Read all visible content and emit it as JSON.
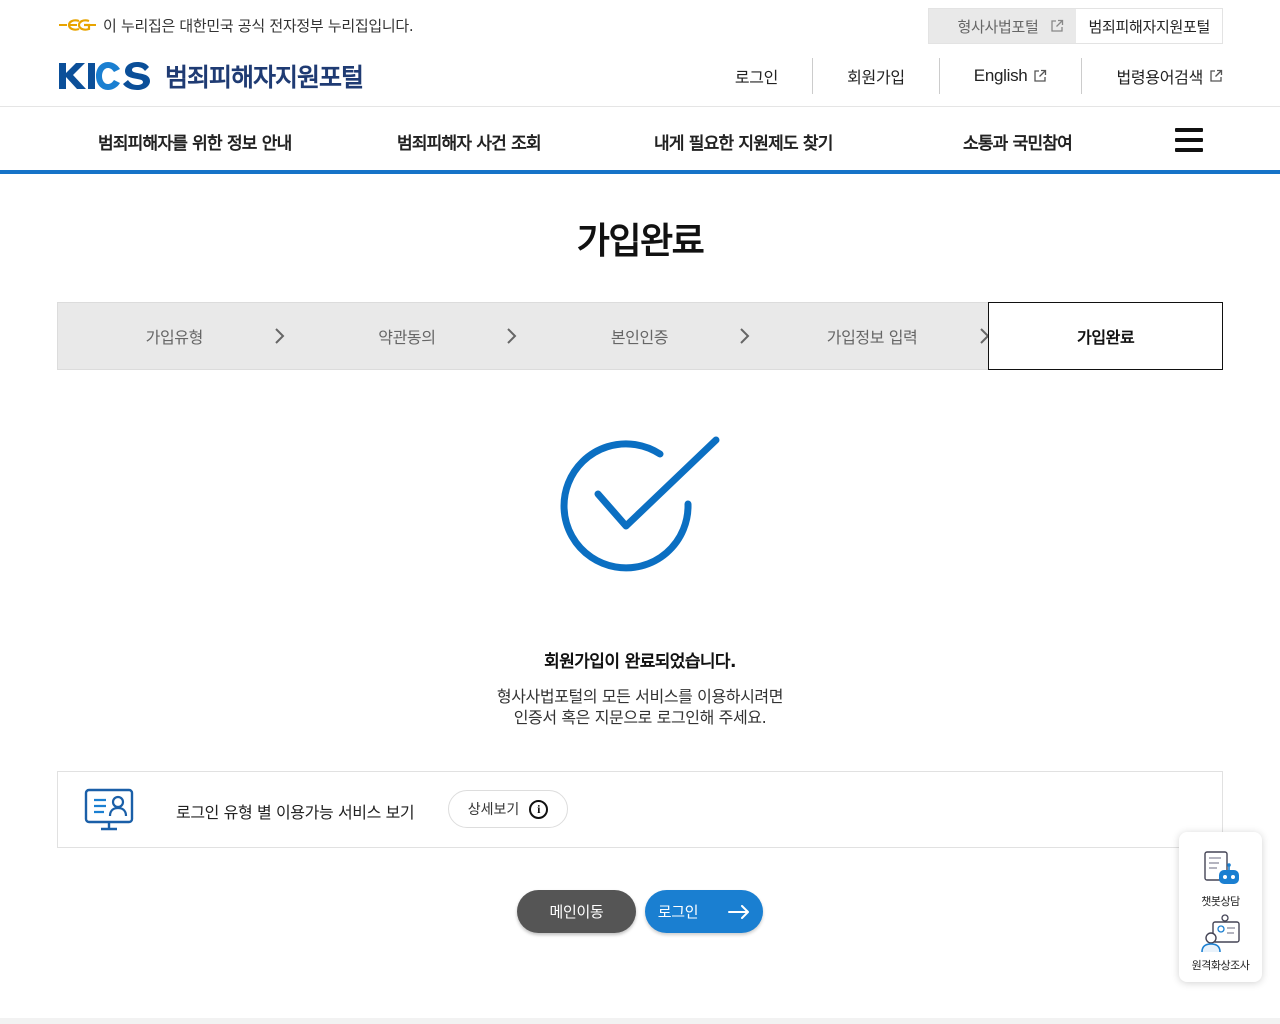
{
  "gov_banner": {
    "text": "이 누리집은 대한민국 공식 전자정부 누리집입니다."
  },
  "portal_tabs": [
    {
      "label": "형사사법포털",
      "active": false
    },
    {
      "label": "범죄피해자지원포털",
      "active": true
    }
  ],
  "logo": {
    "brand": "KICS",
    "portal_name": "범죄피해자지원포털"
  },
  "util_nav": [
    {
      "label": "로그인",
      "external": false
    },
    {
      "label": "회원가입",
      "external": false
    },
    {
      "label": "English",
      "external": true
    },
    {
      "label": "법령용어검색",
      "external": true
    }
  ],
  "gnb": [
    {
      "label": "범죄피해자를 위한 정보 안내"
    },
    {
      "label": "범죄피해자 사건 조회"
    },
    {
      "label": "내게 필요한 지원제도 찾기"
    },
    {
      "label": "소통과 국민참여"
    }
  ],
  "page_title": "가입완료",
  "steps": [
    {
      "label": "가입유형",
      "current": false
    },
    {
      "label": "약관동의",
      "current": false
    },
    {
      "label": "본인인증",
      "current": false
    },
    {
      "label": "가입정보 입력",
      "current": false
    },
    {
      "label": "가입완료",
      "current": true
    }
  ],
  "done": {
    "message": "회원가입이 완료되었습니다.",
    "desc_line1": "형사사법포털의 모든 서비스를 이용하시려면",
    "desc_line2": "인증서 혹은 지문으로 로그인해 주세요."
  },
  "info_box": {
    "text": "로그인 유형 별 이용가능 서비스 보기",
    "detail_label": "상세보기"
  },
  "buttons": {
    "main": "메인이동",
    "login": "로그인"
  },
  "float_widget": {
    "chatbot": "챗봇상담",
    "video": "원격화상조사"
  },
  "colors": {
    "accent": "#1673c8",
    "check": "#0b6fc2",
    "brand": "#0b5aa6"
  }
}
